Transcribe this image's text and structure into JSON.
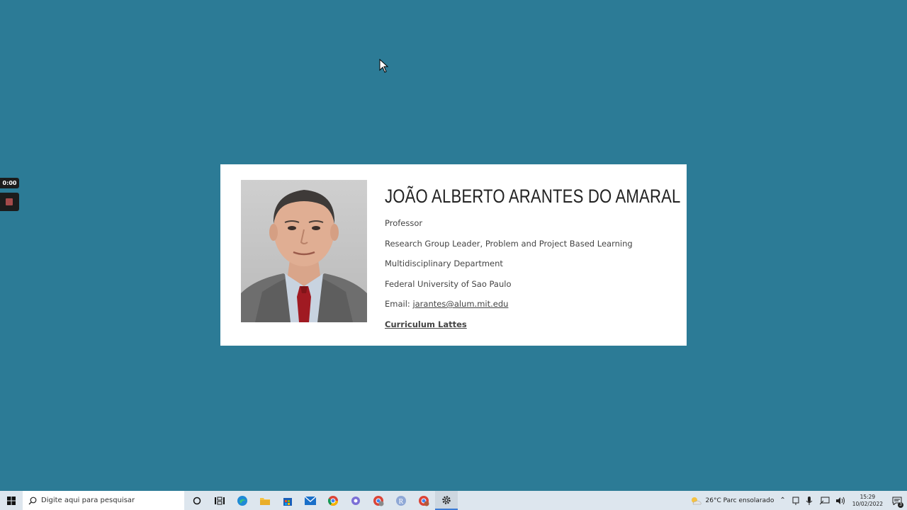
{
  "recorder": {
    "timer": "0:00"
  },
  "profile": {
    "name": "JOÃO ALBERTO ARANTES DO AMARAL",
    "title": "Professor",
    "role": "Research Group Leader, Problem and Project Based Learning",
    "department": "Multidisciplinary Department",
    "university": "Federal University of Sao Paulo",
    "email_label": "Email: ",
    "email": "jarantes@alum.mit.edu",
    "cv_link": "Curriculum Lattes"
  },
  "taskbar": {
    "search_placeholder": "Digite aqui para pesquisar",
    "weather": "26°C  Parc ensolarado",
    "time": "15:29",
    "date": "10/02/2022",
    "notification_count": "3"
  }
}
